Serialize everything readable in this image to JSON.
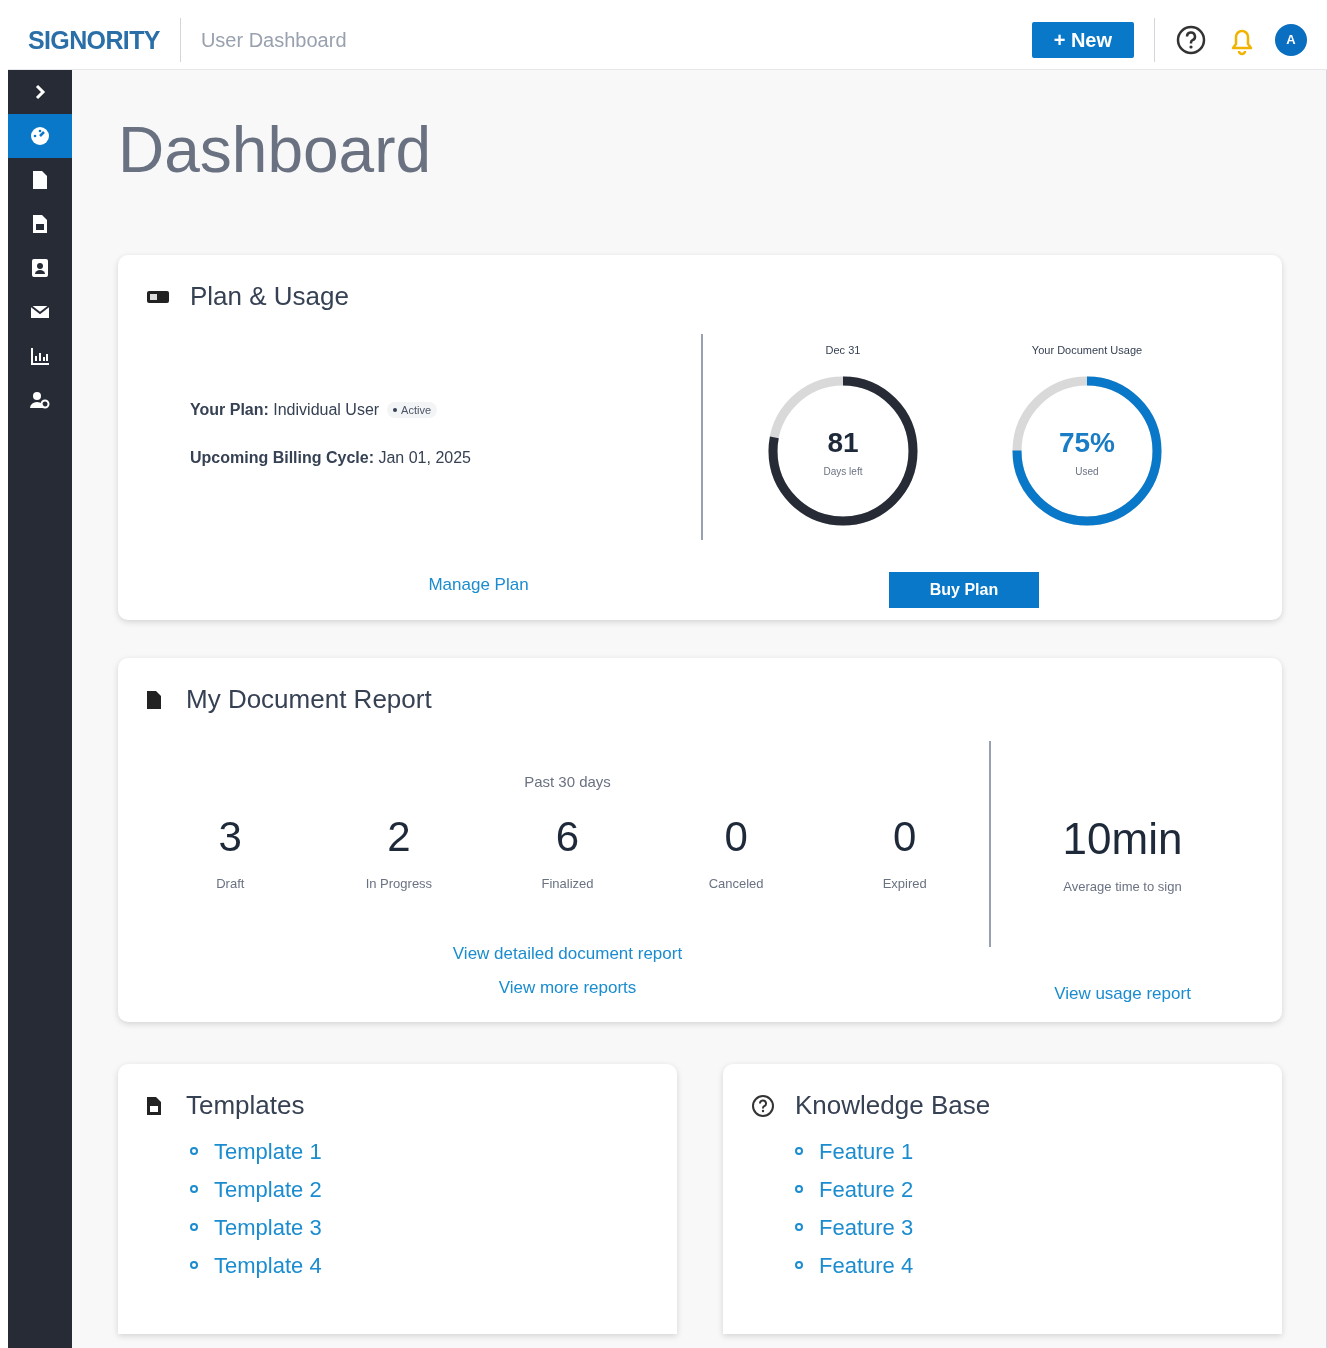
{
  "header": {
    "logo": "SIGNORITY",
    "title": "User Dashboard",
    "new_button": "+ New",
    "avatar": "A"
  },
  "sidebar": {
    "items": [
      {
        "kind": "expand",
        "selected": false
      },
      {
        "kind": "dashboard",
        "selected": true
      },
      {
        "kind": "document",
        "selected": false
      },
      {
        "kind": "template",
        "selected": false
      },
      {
        "kind": "contacts",
        "selected": false
      },
      {
        "kind": "mail",
        "selected": false
      },
      {
        "kind": "reports",
        "selected": false
      },
      {
        "kind": "users",
        "selected": false
      }
    ]
  },
  "page_title": "Dashboard",
  "plan_usage": {
    "title": "Plan & Usage",
    "plan_label": "Your Plan:",
    "plan_value": "Individual User",
    "plan_status": "Active",
    "billing_label": "Upcoming Billing Cycle:",
    "billing_value": "Jan 01, 2025",
    "manage_link": "Manage Plan",
    "buy_button": "Buy Plan",
    "meters": [
      {
        "kind": "days",
        "caption": "Dec 31",
        "value": "81",
        "sublabel": "Days left",
        "level": 0.78
      },
      {
        "kind": "usage",
        "caption": "Your Document Usage",
        "value": "75%",
        "sublabel": "Used",
        "level": 0.75
      }
    ]
  },
  "document_report": {
    "title": "My Document Report",
    "period": "Past 30 days",
    "stats": [
      {
        "value": "3",
        "label": "Draft"
      },
      {
        "value": "2",
        "label": "In Progress"
      },
      {
        "value": "6",
        "label": "Finalized"
      },
      {
        "value": "0",
        "label": "Canceled"
      },
      {
        "value": "0",
        "label": "Expired"
      }
    ],
    "average": {
      "value": "10min",
      "label": "Average time to sign"
    },
    "links": [
      "View detailed document report",
      "View more reports"
    ],
    "usage_link": "View usage report"
  },
  "templates": {
    "title": "Templates",
    "items": [
      "Template 1",
      "Template 2",
      "Template 3",
      "Template 4"
    ]
  },
  "knowledge_base": {
    "title": "Knowledge Base",
    "items": [
      "Feature 1",
      "Feature 2",
      "Feature 3",
      "Feature 4"
    ]
  }
}
